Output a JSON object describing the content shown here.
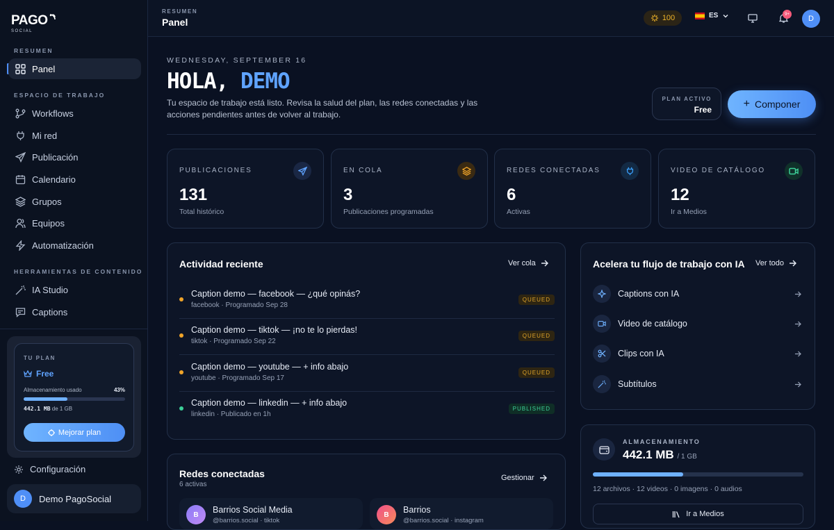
{
  "brand": {
    "logo": "PAGO",
    "sub": "SOCIAL"
  },
  "sidebar": {
    "section_overview": "RESUMEN",
    "section_workspace": "ESPACIO DE TRABAJO",
    "section_tools": "HERRAMIENTAS DE CONTENIDO",
    "items": [
      {
        "label": "Panel",
        "icon": "grid-icon"
      },
      {
        "label": "Workflows",
        "icon": "git-branch-icon"
      },
      {
        "label": "Mi red",
        "icon": "plug-icon"
      },
      {
        "label": "Publicación",
        "icon": "send-icon"
      },
      {
        "label": "Calendario",
        "icon": "calendar-icon"
      },
      {
        "label": "Grupos",
        "icon": "layers-icon"
      },
      {
        "label": "Equipos",
        "icon": "users-icon"
      },
      {
        "label": "Automatización",
        "icon": "bolt-icon"
      },
      {
        "label": "IA Studio",
        "icon": "wand-icon"
      },
      {
        "label": "Captions",
        "icon": "caption-icon"
      }
    ],
    "plan": {
      "label": "TU PLAN",
      "name": "Free",
      "storage_label": "Almacenamiento usado",
      "storage_percent": "43%",
      "storage_fraction": 0.43,
      "storage_used": "442.1 MB",
      "storage_of": "de 1 GB",
      "upgrade": "Mejorar plan"
    },
    "settings": "Configuración",
    "user": {
      "initial": "D",
      "name": "Demo PagoSocial"
    }
  },
  "topbar": {
    "section": "RESUMEN",
    "title": "Panel",
    "credits": "100",
    "lang": "ES",
    "notif_count": "9+",
    "avatar": "D"
  },
  "hero": {
    "date": "WEDNESDAY, SEPTEMBER 16",
    "greeting": "HOLA,",
    "name": "DEMO",
    "intro": "Tu espacio de trabajo está listo. Revisa la salud del plan, las redes conectadas y las acciones pendientes antes de volver al trabajo.",
    "plan_label": "PLAN ACTIVO",
    "plan_value": "Free",
    "compose": "Componer"
  },
  "stats": [
    {
      "label": "PUBLICACIONES",
      "value": "131",
      "sub": "Total histórico",
      "color": "#5fa3ff"
    },
    {
      "label": "EN COLA",
      "value": "3",
      "sub": "Publicaciones programadas",
      "color": "#f0a429"
    },
    {
      "label": "REDES CONECTADAS",
      "value": "6",
      "sub": "Activas",
      "color": "#3aa0ff"
    },
    {
      "label": "VIDEO DE CATÁLOGO",
      "value": "12",
      "sub": "Ir a Medios",
      "color": "#3ccf98"
    }
  ],
  "activity": {
    "title": "Actividad reciente",
    "link": "Ver cola",
    "items": [
      {
        "title": "Caption demo — facebook — ¿qué opinás?",
        "meta": "facebook · Programado Sep 28",
        "status": "QUEUED"
      },
      {
        "title": "Caption demo — tiktok — ¡no te lo pierdas!",
        "meta": "tiktok · Programado Sep 22",
        "status": "QUEUED"
      },
      {
        "title": "Caption demo — youtube — + info abajo",
        "meta": "youtube · Programado Sep 17",
        "status": "QUEUED"
      },
      {
        "title": "Caption demo — linkedin — + info abajo",
        "meta": "linkedin · Publicado en 1h",
        "status": "PUBLISHED"
      }
    ]
  },
  "ai": {
    "title": "Acelera tu flujo de trabajo con IA",
    "link": "Ver todo",
    "items": [
      {
        "label": "Captions con IA"
      },
      {
        "label": "Video de catálogo"
      },
      {
        "label": "Clips con IA"
      },
      {
        "label": "Subtítulos"
      }
    ]
  },
  "storage": {
    "label": "ALMACENAMIENTO",
    "value": "442.1 MB",
    "of": "/ 1 GB",
    "fraction": 0.43,
    "meta": "12 archivos · 12 videos · 0 imagens · 0 audios",
    "button": "Ir a Medios"
  },
  "networks": {
    "title": "Redes conectadas",
    "sub": "6 activas",
    "link": "Gestionar",
    "items": [
      {
        "name": "Barrios Social Media",
        "handle": "@barrios.social · tiktok",
        "initial": "B"
      },
      {
        "name": "Barrios",
        "handle": "@barrios.social · instagram",
        "initial": "B"
      }
    ]
  }
}
